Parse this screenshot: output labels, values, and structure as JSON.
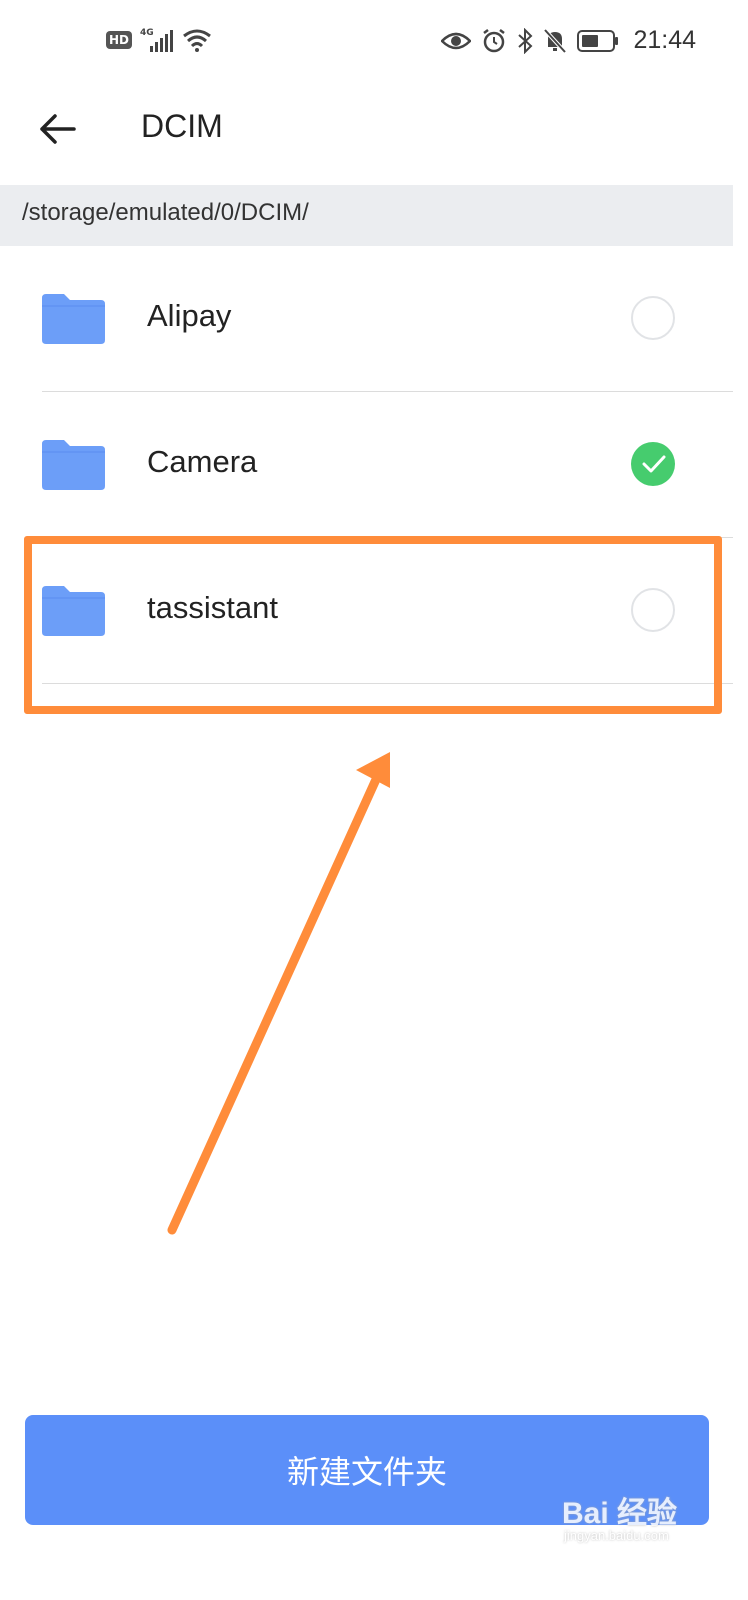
{
  "status_bar": {
    "hd_badge": "HD",
    "network_label": "4G",
    "time": "21:44",
    "icons": [
      "eye-icon",
      "alarm-icon",
      "bluetooth-icon",
      "mute-bell-icon",
      "battery-icon"
    ]
  },
  "header": {
    "back_icon": "arrow-left-icon",
    "title": "DCIM"
  },
  "path": "/storage/emulated/0/DCIM/",
  "folders": [
    {
      "name": "Alipay",
      "checked": false
    },
    {
      "name": "Camera",
      "checked": true
    },
    {
      "name": "tassistant",
      "checked": false
    }
  ],
  "new_folder_button": "新建文件夹",
  "watermark": {
    "brand": "Bai 经验",
    "domain": "jingyan.baidu.com"
  },
  "colors": {
    "folder": "#6c9ef8",
    "check": "#46cc6e",
    "button": "#5b8ff9",
    "annotation": "#ff8c3a",
    "path_bg": "#ebedf0"
  }
}
